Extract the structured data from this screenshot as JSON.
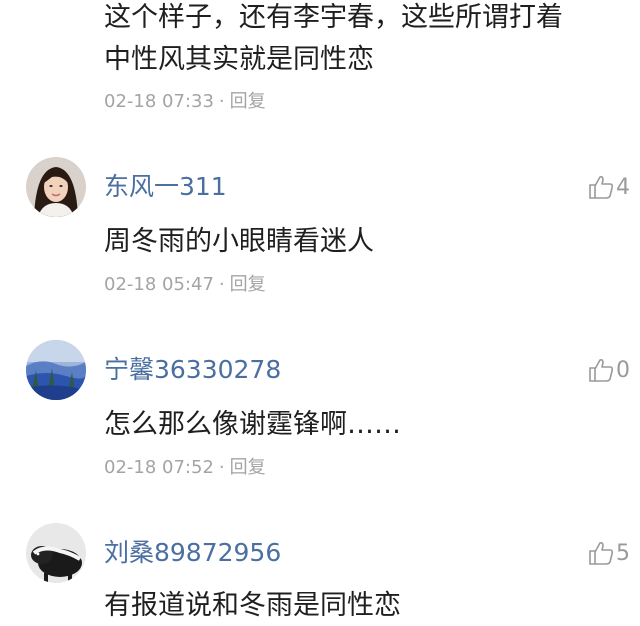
{
  "partial_comment": {
    "text_lines": [
      "这个样子，还有李宇春，这些所谓打着",
      "中性风其实就是同性恋"
    ],
    "time": "02-18 07:33",
    "separator": "·",
    "reply_label": "回复"
  },
  "comments": [
    {
      "username": "东风一311",
      "likes": "4",
      "text": "周冬雨的小眼睛看迷人",
      "time": "02-18 05:47",
      "separator": "·",
      "reply_label": "回复"
    },
    {
      "username": "宁馨36330278",
      "likes": "0",
      "text": "怎么那么像谢霆锋啊……",
      "time": "02-18 07:52",
      "separator": "·",
      "reply_label": "回复"
    },
    {
      "username": "刘桑89872956",
      "likes": "5",
      "text": "有报道说和冬雨是同性恋"
    }
  ],
  "colors": {
    "username": "#4a6fa0",
    "meta": "#a4a4a4",
    "text": "#1f1f1f",
    "like_icon": "#9a9a9a"
  },
  "icons": [
    "thumbs-up-icon"
  ]
}
